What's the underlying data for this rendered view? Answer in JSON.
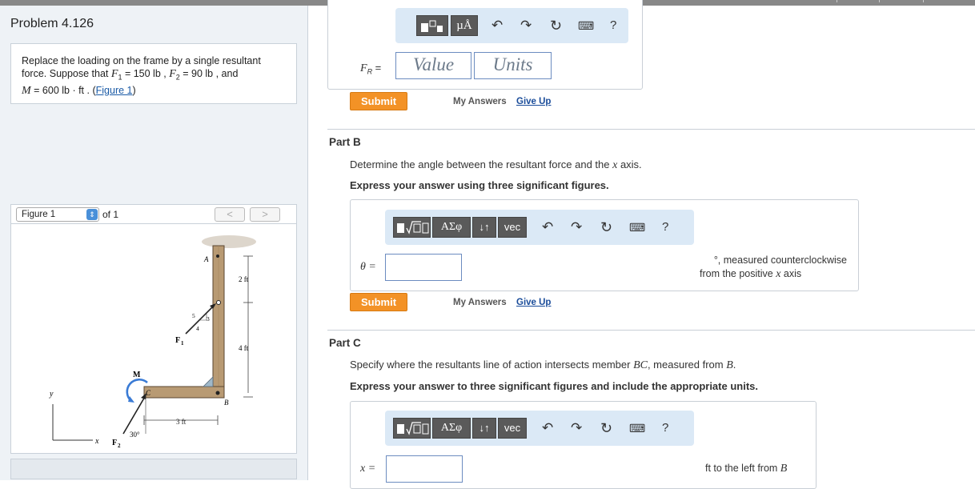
{
  "problem": {
    "title": "Problem 4.126",
    "statement_line1": "Replace the loading on the frame by a single resultant",
    "statement_l2_a": "force. Suppose that ",
    "F1_sym": "F",
    "F1_sub": "1",
    "F1_val": " = 150  lb , ",
    "F2_sym": "F",
    "F2_sub": "2",
    "F2_val": " = 90  lb , and",
    "M_sym": "M",
    "M_val": " = 600  lb · ft . (",
    "fig_link": "Figure 1",
    "close_paren": ")"
  },
  "figure": {
    "select_value": "Figure 1",
    "of_text": "of 1",
    "prev": "<",
    "next": ">",
    "labels": {
      "A": "A",
      "B": "B",
      "C": "C",
      "two_ft": "2 ft",
      "four_ft": "4 ft",
      "three_ft": "3 ft",
      "F1": "F",
      "F1sub": "1",
      "F2": "F",
      "F2sub": "2",
      "M": "M",
      "y": "y",
      "x": "x",
      "five": "5",
      "three": "3",
      "four": "4",
      "thirty": "30°"
    }
  },
  "partA": {
    "label_sym": "F",
    "label_sub": "R",
    "label_eq": " =",
    "value_placeholder": "Value",
    "units_placeholder": "Units",
    "submit": "Submit",
    "my_answers": "My Answers",
    "give_up": "Give Up",
    "toolbar": {
      "units_icon": "µÅ",
      "help": "?"
    }
  },
  "partB": {
    "title": "Part B",
    "question_a": "Determine the angle between the resultant force and the ",
    "question_x": "x",
    "question_b": " axis.",
    "instruction": "Express your answer using three significant figures.",
    "toolbar": {
      "greek": "ΑΣφ",
      "swap": "↓↑",
      "vec": "vec",
      "help": "?"
    },
    "label": "θ =",
    "unit_line1": "°, measured counterclockwise",
    "unit_line2a": "from the positive ",
    "unit_x": "x",
    "unit_line2b": " axis",
    "submit": "Submit",
    "my_answers": "My Answers",
    "give_up": "Give Up"
  },
  "partC": {
    "title": "Part C",
    "question_a": "Specify where the resultants line of action intersects member ",
    "question_bc": "BC",
    "question_b": ", measured from ",
    "question_B": "B",
    "question_end": ".",
    "instruction": "Express your answer to three significant figures and include the appropriate units.",
    "toolbar": {
      "greek": "ΑΣφ",
      "swap": "↓↑",
      "vec": "vec",
      "help": "?"
    },
    "label": "x =",
    "unit_a": "ft to the left from ",
    "unit_B": "B"
  }
}
